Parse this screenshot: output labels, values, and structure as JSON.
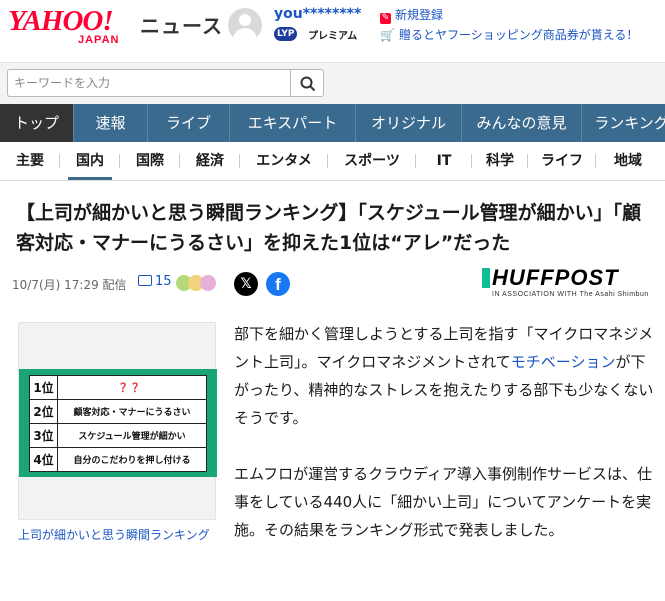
{
  "header": {
    "logo_main": "YAHOO!",
    "logo_sub": "JAPAN",
    "section": "ニュース",
    "username": "you********",
    "lyp_badge": "LYP",
    "premium": "プレミアム",
    "signup": "新規登録",
    "promo": "贈るとヤフーショッピング商品券が貰える！"
  },
  "search": {
    "placeholder": "キーワードを入力"
  },
  "main_nav": [
    {
      "label": "トップ",
      "active": true
    },
    {
      "label": "速報"
    },
    {
      "label": "ライブ"
    },
    {
      "label": "エキスパート"
    },
    {
      "label": "オリジナル"
    },
    {
      "label": "みんなの意見"
    },
    {
      "label": "ランキング"
    }
  ],
  "sub_nav": [
    {
      "label": "主要"
    },
    {
      "label": "国内",
      "active": true
    },
    {
      "label": "国際"
    },
    {
      "label": "経済"
    },
    {
      "label": "エンタメ"
    },
    {
      "label": "スポーツ"
    },
    {
      "label": "IT"
    },
    {
      "label": "科学"
    },
    {
      "label": "ライフ"
    },
    {
      "label": "地域"
    }
  ],
  "article": {
    "title": "【上司が細かいと思う瞬間ランキング】「スケジュール管理が細かい」「顧客対応・マナーにうるさい」を抑えた1位は“アレ”だった",
    "date": "10/7(月) 17:29 配信",
    "comment_count": "15",
    "source_name": "HUFFPOST",
    "source_sub": "IN ASSOCIATION WITH The Asahi Shimbun",
    "figure": {
      "rows": [
        {
          "rank": "1位",
          "text": "？？"
        },
        {
          "rank": "2位",
          "text": "顧客対応・マナーにうるさい"
        },
        {
          "rank": "3位",
          "text": "スケジュール管理が細かい"
        },
        {
          "rank": "4位",
          "text": "自分のこだわりを押し付ける"
        }
      ],
      "caption": "上司が細かいと思う瞬間ランキング"
    },
    "para1_a": "部下を細かく管理しようとする上司を指す「マイクロマネジメント上司」。マイクロマネジメントされて",
    "para1_link": "モチベーション",
    "para1_b": "が下がったり、精神的なストレスを抱えたりする部下も少なくないそうです。",
    "para2": "エムフロが運営するクラウディア導入事例制作サービスは、仕事をしている440人に「細かい上司」についてアンケートを実施。その結果をランキング形式で発表しました。"
  },
  "colors": {
    "brand_red": "#ff0033",
    "nav_blue": "#3b6a8f",
    "link_blue": "#1a55c4",
    "figure_green": "#19a577",
    "huff_green": "#0dbe98"
  },
  "icons": [
    "search-icon",
    "signup-icon",
    "gift-icon",
    "comment-icon",
    "x-icon",
    "facebook-icon",
    "avatar-icon"
  ]
}
